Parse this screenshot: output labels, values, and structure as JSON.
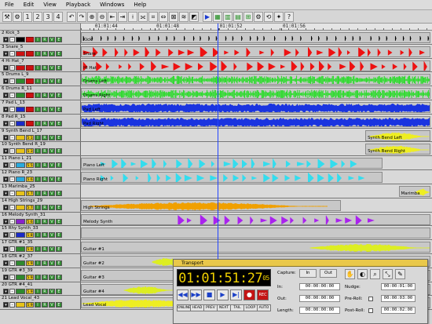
{
  "menu": [
    "File",
    "Edit",
    "View",
    "Playback",
    "Windows",
    "Help"
  ],
  "toolbar": [
    {
      "icon": "wrench-icon",
      "glyph": "⚒"
    },
    {
      "icon": "gear-icon",
      "glyph": "⚙"
    },
    {
      "icon": "tracks-1-icon",
      "glyph": "1"
    },
    {
      "icon": "tracks-2-icon",
      "glyph": "2"
    },
    {
      "icon": "tracks-3-icon",
      "glyph": "3"
    },
    {
      "icon": "tracks-4-icon",
      "glyph": "4"
    },
    {
      "icon": "undo-icon",
      "glyph": "↶"
    },
    {
      "icon": "redo-icon",
      "glyph": "↷"
    },
    {
      "icon": "zoom-in-icon",
      "glyph": "⊕"
    },
    {
      "icon": "zoom-out-icon",
      "glyph": "⊖"
    },
    {
      "icon": "nudge-left-icon",
      "glyph": "⇤"
    },
    {
      "icon": "nudge-right-icon",
      "glyph": "⇥"
    },
    {
      "icon": "split-icon",
      "glyph": "⟊"
    },
    {
      "icon": "join-icon",
      "glyph": "⟗"
    },
    {
      "icon": "crop-icon",
      "glyph": "⌗"
    },
    {
      "icon": "fit-icon",
      "glyph": "⇔"
    },
    {
      "icon": "snap-icon",
      "glyph": "⊠"
    },
    {
      "icon": "ripple-icon",
      "glyph": "≋"
    },
    {
      "icon": "color-icon",
      "glyph": "◩"
    },
    {
      "icon": "play-icon",
      "glyph": "▶"
    },
    {
      "icon": "mixer-icon",
      "glyph": "▦"
    },
    {
      "icon": "meters-icon",
      "glyph": "▥"
    },
    {
      "icon": "edit-window-icon",
      "glyph": "▤"
    },
    {
      "icon": "markers-icon",
      "glyph": "⊞"
    },
    {
      "icon": "settings-icon",
      "glyph": "⚙"
    },
    {
      "icon": "loop-icon",
      "glyph": "⟲"
    },
    {
      "icon": "fx-icon",
      "glyph": "✦"
    },
    {
      "icon": "help-icon",
      "glyph": "?"
    }
  ],
  "ruler": {
    "labels": [
      {
        "text": "01:01:44",
        "frac": 0.04
      },
      {
        "text": "01:01:48",
        "frac": 0.215
      },
      {
        "text": "01:01:52",
        "frac": 0.395
      },
      {
        "text": "01:01:56",
        "frac": 0.575
      }
    ]
  },
  "playhead_frac": 0.39,
  "tracks": [
    {
      "num": "2",
      "name": "Kick_3",
      "color": "#000000",
      "slot": "",
      "clips": [
        {
          "label": "Kick",
          "start": 0.0,
          "end": 0.995,
          "wave": "ticks",
          "wcolor": "#000000",
          "wstart": 0.0,
          "wend": 0.995
        }
      ]
    },
    {
      "num": "3",
      "name": "Snare_5",
      "color": "#cc1111",
      "slot": "",
      "clips": [
        {
          "label": "Snare",
          "start": 0.0,
          "end": 0.995,
          "wave": "hits",
          "wcolor": "#ee1111",
          "wstart": 0.0,
          "wend": 0.995
        }
      ]
    },
    {
      "num": "4",
      "name": "Hi Hat_7",
      "color": "#cc1111",
      "slot": "",
      "clips": [
        {
          "label": "Hi Hat",
          "start": 0.0,
          "end": 0.995,
          "wave": "hits",
          "wcolor": "#ee1111",
          "wstart": 0.0,
          "wend": 0.995
        }
      ]
    },
    {
      "num": "5",
      "name": "Drums L_9",
      "color": "#2e8a2e",
      "slot": "",
      "clips": [
        {
          "label": "Drums Left",
          "start": 0.0,
          "end": 0.995,
          "wave": "dense",
          "wcolor": "#22dd22",
          "wstart": 0.0,
          "wend": 0.995
        }
      ]
    },
    {
      "num": "6",
      "name": "Drums R_11",
      "color": "#2e8a2e",
      "slot": "",
      "clips": [
        {
          "label": "Drums Right",
          "start": 0.0,
          "end": 0.995,
          "wave": "dense",
          "wcolor": "#22dd22",
          "wstart": 0.0,
          "wend": 0.995
        }
      ]
    },
    {
      "num": "7",
      "name": "Pad L_13",
      "color": "#1a2ac8",
      "slot": "",
      "clips": [
        {
          "label": "Pad Left",
          "start": 0.0,
          "end": 0.995,
          "wave": "block",
          "wcolor": "#1a34e0",
          "wstart": 0.0,
          "wend": 0.995
        }
      ]
    },
    {
      "num": "8",
      "name": "Pad R_15",
      "color": "#1a2ac8",
      "slot": "",
      "clips": [
        {
          "label": "Pad Right",
          "start": 0.0,
          "end": 0.995,
          "wave": "block",
          "wcolor": "#1a34e0",
          "wstart": 0.0,
          "wend": 0.995
        }
      ]
    },
    {
      "num": "9",
      "name": "Synth Bend L_17",
      "color": "#e6c21a",
      "slot": "5 1",
      "clips": [
        {
          "label": "Synth Bend Left",
          "start": 0.81,
          "end": 0.995,
          "wave": "swell",
          "wcolor": "#eeee22",
          "wstart": 0.82,
          "wend": 0.99
        }
      ]
    },
    {
      "num": "10",
      "name": "Synth Bend R_19",
      "color": "#e6c21a",
      "slot": "5 3",
      "clips": [
        {
          "label": "Synth Bend Right",
          "start": 0.81,
          "end": 0.995,
          "wave": "swell",
          "wcolor": "#eeee22",
          "wstart": 0.82,
          "wend": 0.99
        }
      ]
    },
    {
      "num": "11",
      "name": "Piano L_21",
      "color": "#2aaadd",
      "slot": "5 5",
      "clips": [
        {
          "label": "Piano Left",
          "start": 0.0,
          "end": 0.86,
          "wave": "hits",
          "wcolor": "#33ddee",
          "wstart": 0.05,
          "wend": 0.8
        }
      ]
    },
    {
      "num": "12",
      "name": "Piano R_23",
      "color": "#2aaadd",
      "slot": "5 6",
      "clips": [
        {
          "label": "Piano Right",
          "start": 0.0,
          "end": 0.86,
          "wave": "hits",
          "wcolor": "#33ddee",
          "wstart": 0.05,
          "wend": 0.8
        }
      ]
    },
    {
      "num": "13",
      "name": "Marimba_25",
      "color": "#e6c21a",
      "slot": "5 7",
      "clips": [
        {
          "label": "Marimba",
          "start": 0.905,
          "end": 0.995,
          "wave": "swell",
          "wcolor": "#eeee22",
          "wstart": 0.95,
          "wend": 0.99
        }
      ]
    },
    {
      "num": "14",
      "name": "High Strings_29",
      "color": "#e6c21a",
      "slot": "5 7",
      "clips": [
        {
          "label": "High Strings",
          "start": 0.0,
          "end": 0.74,
          "wave": "swell",
          "wcolor": "#f0a000",
          "wstart": 0.02,
          "wend": 0.7
        }
      ]
    },
    {
      "num": "16",
      "name": "Melody Synth_31",
      "color": "#8822cc",
      "slot": "5 6",
      "clips": [
        {
          "label": "Melody Synth",
          "start": 0.0,
          "end": 0.995,
          "wave": "hits",
          "wcolor": "#aa22ee",
          "wstart": 0.27,
          "wend": 0.83
        }
      ]
    },
    {
      "num": "15",
      "name": "Rhy Synth_33",
      "color": "#1a2ac8",
      "slot": "5 8",
      "clips": [
        {
          "label": "",
          "start": 0.0,
          "end": 0.995,
          "wave": "none",
          "wcolor": "#1a34e0",
          "wstart": 0.0,
          "wend": 0.0
        }
      ]
    },
    {
      "num": "17",
      "name": "GTR #1_35",
      "color": "#2e8a2e",
      "slot": "5 9",
      "clips": [
        {
          "label": "Guitar #1",
          "start": 0.0,
          "end": 0.995,
          "wave": "swell",
          "wcolor": "#ddee22",
          "wstart": 0.65,
          "wend": 0.995
        }
      ]
    },
    {
      "num": "18",
      "name": "GTR #2_37",
      "color": "#2e8a2e",
      "slot": "5 9",
      "clips": [
        {
          "label": "Guitar #2",
          "start": 0.0,
          "end": 0.995,
          "wave": "swell",
          "wcolor": "#ddee22",
          "wstart": 0.2,
          "wend": 0.3
        }
      ]
    },
    {
      "num": "19",
      "name": "GTR #3_39",
      "color": "#2e8a2e",
      "slot": "5 9",
      "clips": [
        {
          "label": "Guitar #3",
          "start": 0.0,
          "end": 0.995,
          "wave": "none",
          "wcolor": "#ddee22",
          "wstart": 0.0,
          "wend": 0.0
        }
      ]
    },
    {
      "num": "20",
      "name": "GTR #4_41",
      "color": "#2e8a2e",
      "slot": "5 9",
      "clips": [
        {
          "label": "Guitar #4",
          "start": 0.0,
          "end": 0.995,
          "wave": "swell",
          "wcolor": "#ddee22",
          "wstart": 0.12,
          "wend": 0.26
        }
      ]
    },
    {
      "num": "21",
      "name": "Lead Vocal_43",
      "color": "#e6c21a",
      "slot": "5 9",
      "clips": [
        {
          "label": "Lead Vocal",
          "start": 0.0,
          "end": 0.995,
          "wave": "swell",
          "wcolor": "#eeee22",
          "wstart": 0.0,
          "wend": 0.4
        }
      ]
    }
  ],
  "track_buttons": {
    "input": "I",
    "record_arm": "R",
    "view": "V",
    "edit": "E"
  },
  "transport": {
    "title": "Transport",
    "timecode": "01:01:51:27",
    "timecode_sub": "05",
    "capture_label": "Capture:",
    "in_button": "In",
    "out_button": "Out",
    "in_label": "In:",
    "out_label": "Out:",
    "length_label": "Length:",
    "in_value": "00:00:00:00",
    "out_value": "00:00:00:00",
    "length_value": "00:00:00:00",
    "nudge_label": "Nudge:",
    "nudge_value": "00:00:01:00",
    "preroll_label": "Pre-Roll:",
    "preroll_value": "00:00:03:00",
    "postroll_label": "Post-Roll:",
    "postroll_value": "00:00:02:00",
    "modes": [
      "ONLINE",
      "HEAD",
      "PREV",
      "NEXT",
      "TAIL",
      "LOOP",
      "AUTO"
    ],
    "buttons": [
      {
        "icon": "rewind-icon",
        "glyph": "◀◀"
      },
      {
        "icon": "fast-forward-icon",
        "glyph": "▶▶"
      },
      {
        "icon": "stop-icon",
        "glyph": "■"
      },
      {
        "icon": "play-icon",
        "glyph": "▶"
      },
      {
        "icon": "skip-icon",
        "glyph": "▶|"
      },
      {
        "icon": "punch-icon",
        "glyph": "●"
      },
      {
        "icon": "record-icon",
        "glyph": "REC"
      }
    ]
  }
}
